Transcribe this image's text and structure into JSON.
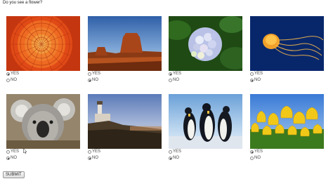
{
  "question": "Do you see a flower?",
  "options": {
    "yes_label": "YES",
    "no_label": "NO"
  },
  "images": [
    {
      "icon": "orange-dahlia-flower-photo",
      "selected": "yes"
    },
    {
      "icon": "desert-mesa-photo",
      "selected": "no"
    },
    {
      "icon": "hydrangea-flower-photo",
      "selected": "yes"
    },
    {
      "icon": "jellyfish-photo",
      "selected": "no"
    },
    {
      "icon": "koala-photo",
      "selected": "no"
    },
    {
      "icon": "lighthouse-photo",
      "selected": "no"
    },
    {
      "icon": "penguins-photo",
      "selected": "no"
    },
    {
      "icon": "yellow-tulips-photo",
      "selected": "yes"
    }
  ],
  "submit_label": "SUBMIT",
  "colors": {
    "dahlia": "#e8531c",
    "desert_sky": "#3d72b8",
    "hydrangea": "#cfd4ee",
    "jellyfish_bg": "#0b2b6e",
    "tulip": "#f2c818"
  }
}
